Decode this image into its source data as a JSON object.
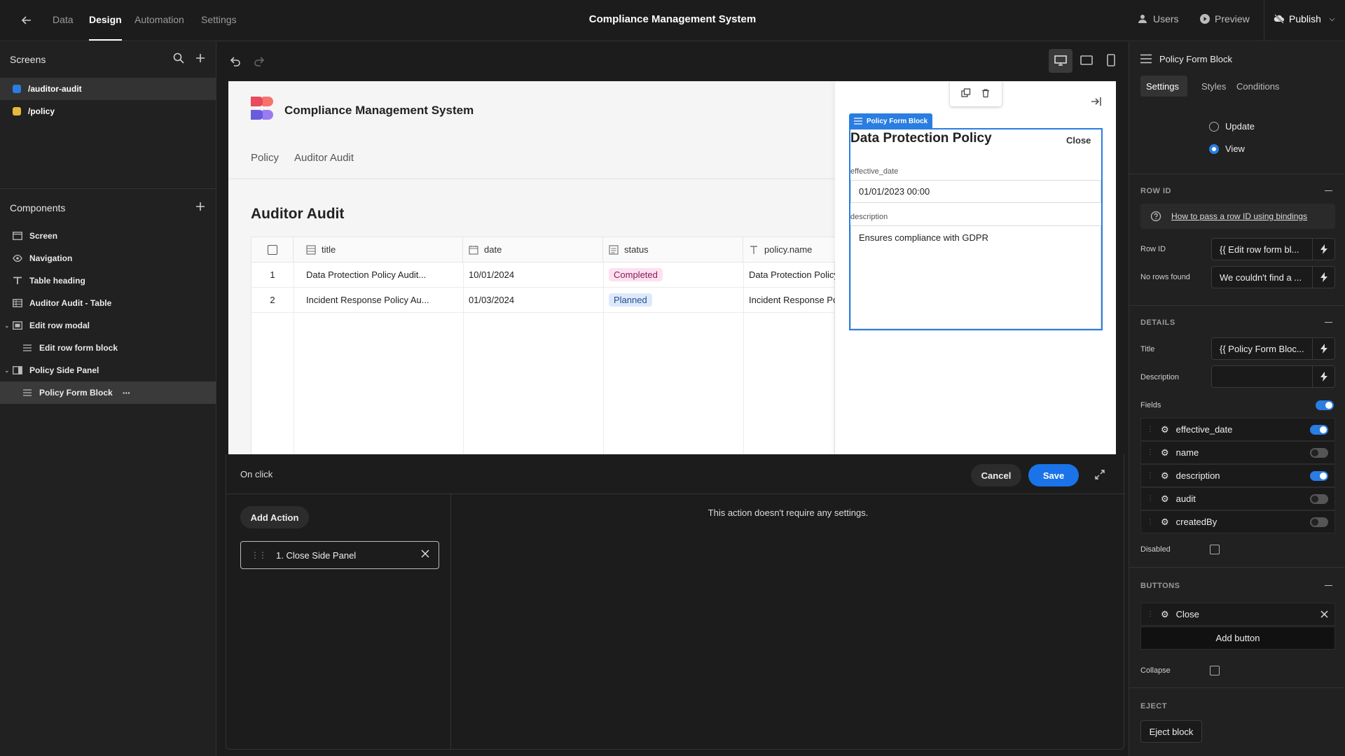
{
  "topbar": {
    "tabs": [
      "Data",
      "Design",
      "Automation",
      "Settings"
    ],
    "active_tab": "Design",
    "title": "Compliance Management System",
    "users_label": "Users",
    "preview_label": "Preview",
    "publish_label": "Publish"
  },
  "left": {
    "screens_title": "Screens",
    "screens": [
      {
        "route": "/auditor-audit",
        "color": "#2a7de1",
        "selected": true
      },
      {
        "route": "/policy",
        "color": "#e8b93a",
        "selected": false
      }
    ],
    "components_title": "Components",
    "components": [
      {
        "label": "Screen",
        "icon": "screen-icon",
        "depth": 0
      },
      {
        "label": "Navigation",
        "icon": "eye-icon",
        "depth": 0
      },
      {
        "label": "Table heading",
        "icon": "text-icon",
        "depth": 0
      },
      {
        "label": "Auditor Audit - Table",
        "icon": "table-icon",
        "depth": 0
      },
      {
        "label": "Edit row modal",
        "icon": "modal-icon",
        "depth": 0
      },
      {
        "label": "Edit row form block",
        "icon": "form-icon",
        "depth": 1
      },
      {
        "label": "Policy Side Panel",
        "icon": "side-panel-icon",
        "depth": 0
      },
      {
        "label": "Policy Form Block",
        "icon": "form-icon",
        "depth": 1
      }
    ]
  },
  "preview": {
    "app_title": "Compliance Management System",
    "nav": [
      "Policy",
      "Auditor Audit"
    ],
    "heading": "Auditor Audit",
    "table": {
      "columns": [
        "title",
        "date",
        "status",
        "policy.name"
      ],
      "rows": [
        {
          "num": "1",
          "title": "Data Protection Policy Audit...",
          "date": "10/01/2024",
          "status": "Completed",
          "policy": "Data Protection Policy"
        },
        {
          "num": "2",
          "title": "Incident Response Policy Au...",
          "date": "01/03/2024",
          "status": "Planned",
          "policy": "Incident Response Policy"
        }
      ]
    },
    "side_panel": {
      "block_tag": "Policy Form Block",
      "form_title": "Data Protection Policy",
      "close_label": "Close",
      "fields": [
        {
          "label": "effective_date",
          "value": "01/01/2023 00:00"
        },
        {
          "label": "description",
          "value": "Ensures compliance with GDPR"
        }
      ]
    }
  },
  "action_panel": {
    "title": "On click",
    "cancel_label": "Cancel",
    "save_label": "Save",
    "add_action_label": "Add Action",
    "actions": [
      "1. Close Side Panel"
    ],
    "message": "This action doesn't require any settings."
  },
  "right": {
    "block_name": "Policy Form Block",
    "tabs": [
      "Settings",
      "Styles",
      "Conditions"
    ],
    "active_tab": "Settings",
    "modes": [
      {
        "label": "Update",
        "checked": false
      },
      {
        "label": "View",
        "checked": true
      }
    ],
    "row_id_section": {
      "title": "ROW ID",
      "help_link": "How to pass a row ID using bindings",
      "row_id_label": "Row ID",
      "row_id_value": "{{ Edit row form bl...",
      "no_rows_label": "No rows found",
      "no_rows_value": "We couldn't find a ..."
    },
    "details": {
      "title": "DETAILS",
      "title_label": "Title",
      "title_value": "{{ Policy Form Bloc...",
      "description_label": "Description",
      "description_value": "",
      "fields_label": "Fields",
      "fields_toggle": true,
      "fields": [
        {
          "name": "effective_date",
          "on": true
        },
        {
          "name": "name",
          "on": false
        },
        {
          "name": "description",
          "on": true
        },
        {
          "name": "audit",
          "on": false
        },
        {
          "name": "createdBy",
          "on": false
        }
      ],
      "disabled_label": "Disabled"
    },
    "buttons": {
      "title": "BUTTONS",
      "items": [
        "Close"
      ],
      "add_label": "Add button",
      "collapse_label": "Collapse"
    },
    "eject": {
      "title": "EJECT",
      "button_label": "Eject block"
    }
  }
}
